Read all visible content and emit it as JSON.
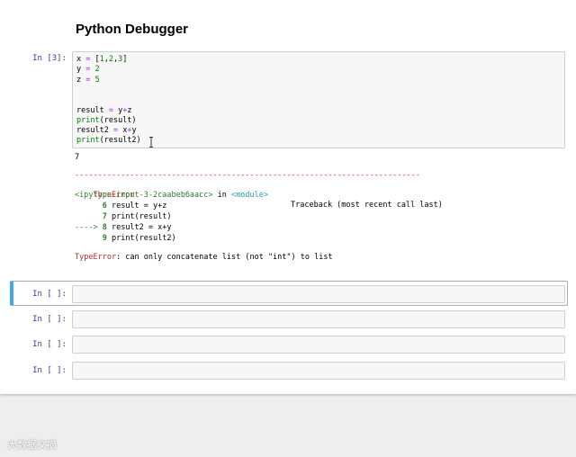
{
  "notebook": {
    "title": "Python Debugger"
  },
  "cell1": {
    "prompt": "In [3]:",
    "code_lines": [
      {
        "tokens": [
          {
            "t": "x ",
            "c": ""
          },
          {
            "t": "=",
            "c": "op"
          },
          {
            "t": " [",
            "c": ""
          },
          {
            "t": "1",
            "c": "num"
          },
          {
            "t": ",",
            "c": ""
          },
          {
            "t": "2",
            "c": "num"
          },
          {
            "t": ",",
            "c": ""
          },
          {
            "t": "3",
            "c": "num"
          },
          {
            "t": "]",
            "c": ""
          }
        ]
      },
      {
        "tokens": [
          {
            "t": "y ",
            "c": ""
          },
          {
            "t": "=",
            "c": "op"
          },
          {
            "t": " ",
            "c": ""
          },
          {
            "t": "2",
            "c": "num"
          }
        ]
      },
      {
        "tokens": [
          {
            "t": "z ",
            "c": ""
          },
          {
            "t": "=",
            "c": "op"
          },
          {
            "t": " ",
            "c": ""
          },
          {
            "t": "5",
            "c": "num"
          }
        ]
      },
      {
        "tokens": []
      },
      {
        "tokens": []
      },
      {
        "tokens": [
          {
            "t": "result ",
            "c": ""
          },
          {
            "t": "=",
            "c": "op"
          },
          {
            "t": " y",
            "c": ""
          },
          {
            "t": "+",
            "c": "op"
          },
          {
            "t": "z",
            "c": ""
          }
        ]
      },
      {
        "tokens": [
          {
            "t": "print",
            "c": "kw"
          },
          {
            "t": "(result)",
            "c": ""
          }
        ]
      },
      {
        "tokens": [
          {
            "t": "result2 ",
            "c": ""
          },
          {
            "t": "=",
            "c": "op"
          },
          {
            "t": " x",
            "c": ""
          },
          {
            "t": "+",
            "c": "op"
          },
          {
            "t": "y",
            "c": ""
          }
        ]
      },
      {
        "tokens": [
          {
            "t": "print",
            "c": "kw"
          },
          {
            "t": "(result2)",
            "c": ""
          }
        ]
      }
    ],
    "stdout": "7",
    "traceback": {
      "separator": "---------------------------------------------------------------------------",
      "error_type": "TypeError",
      "header_right": "Traceback (most recent call last)",
      "location_file": "<ipython-input-3-2caabeb6aacc>",
      "location_in": " in ",
      "location_module": "<module>",
      "frames": [
        {
          "arrow": "      ",
          "lineno": "6",
          "code": " result = y+z"
        },
        {
          "arrow": "      ",
          "lineno": "7",
          "code": " print(result)"
        },
        {
          "arrow": "----> ",
          "lineno": "8",
          "code": " result2 = x+y"
        },
        {
          "arrow": "      ",
          "lineno": "9",
          "code": " print(result2)"
        }
      ],
      "message_type": "TypeError",
      "message": ": can only concatenate list (not \"int\") to list"
    }
  },
  "empty_cells": [
    {
      "prompt": "In [ ]:"
    },
    {
      "prompt": "In [ ]:"
    },
    {
      "prompt": "In [ ]:"
    },
    {
      "prompt": "In [ ]:"
    }
  ],
  "watermark": "大数据文摘"
}
